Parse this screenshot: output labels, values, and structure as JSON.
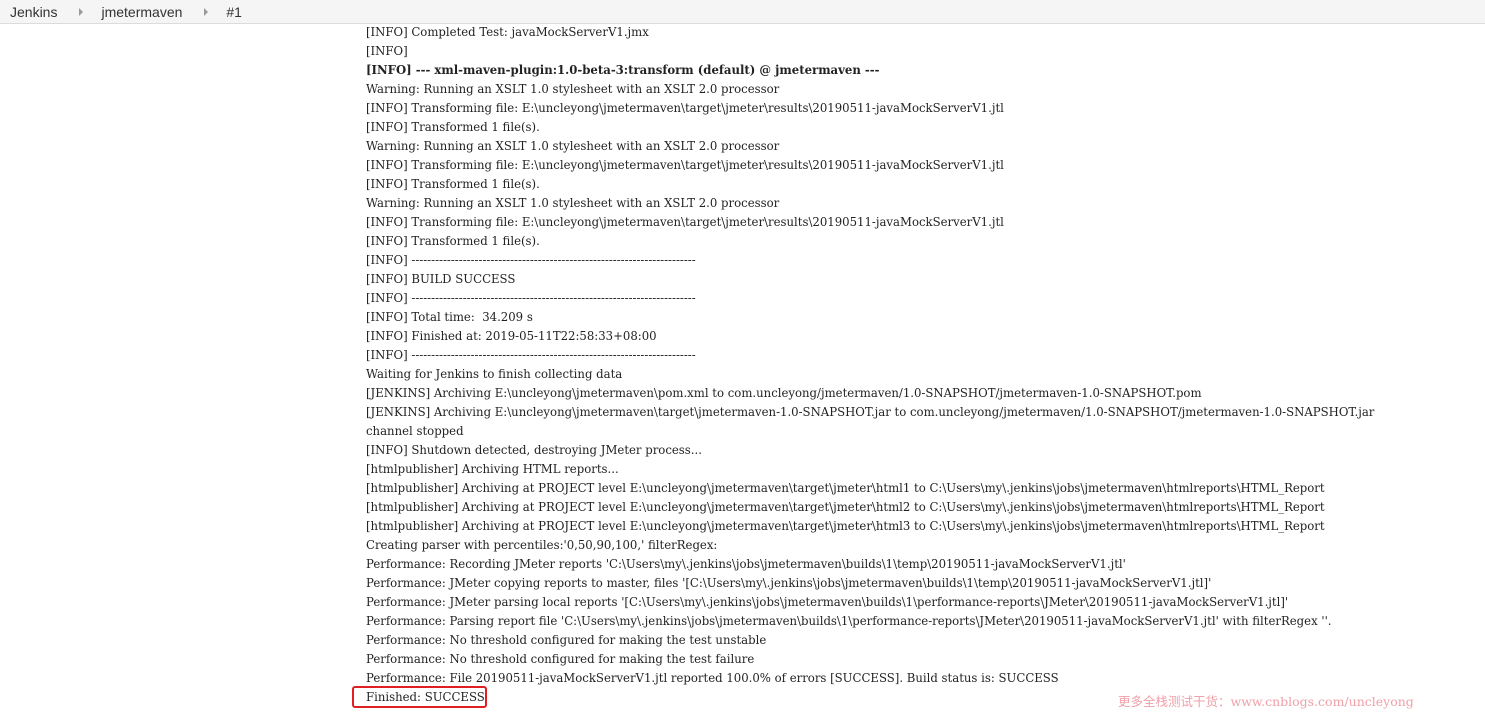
{
  "breadcrumb": {
    "items": [
      {
        "label": "Jenkins"
      },
      {
        "label": "jmetermaven"
      },
      {
        "label": "#1"
      }
    ]
  },
  "console": {
    "lines": [
      {
        "text": "[INFO] Completed Test: javaMockServerV1.jmx",
        "bold": false
      },
      {
        "text": "[INFO]",
        "bold": false
      },
      {
        "text": "[INFO] --- xml-maven-plugin:1.0-beta-3:transform (default) @ jmetermaven ---",
        "bold": true
      },
      {
        "text": "Warning: Running an XSLT 1.0 stylesheet with an XSLT 2.0 processor",
        "bold": false
      },
      {
        "text": "[INFO] Transforming file: E:\\uncleyong\\jmetermaven\\target\\jmeter\\results\\20190511-javaMockServerV1.jtl",
        "bold": false
      },
      {
        "text": "[INFO] Transformed 1 file(s).",
        "bold": false
      },
      {
        "text": "Warning: Running an XSLT 1.0 stylesheet with an XSLT 2.0 processor",
        "bold": false
      },
      {
        "text": "[INFO] Transforming file: E:\\uncleyong\\jmetermaven\\target\\jmeter\\results\\20190511-javaMockServerV1.jtl",
        "bold": false
      },
      {
        "text": "[INFO] Transformed 1 file(s).",
        "bold": false
      },
      {
        "text": "Warning: Running an XSLT 1.0 stylesheet with an XSLT 2.0 processor",
        "bold": false
      },
      {
        "text": "[INFO] Transforming file: E:\\uncleyong\\jmetermaven\\target\\jmeter\\results\\20190511-javaMockServerV1.jtl",
        "bold": false
      },
      {
        "text": "[INFO] Transformed 1 file(s).",
        "bold": false
      },
      {
        "text": "[INFO] ------------------------------------------------------------------------",
        "bold": false
      },
      {
        "text": "[INFO] BUILD SUCCESS",
        "bold": false
      },
      {
        "text": "[INFO] ------------------------------------------------------------------------",
        "bold": false
      },
      {
        "text": "[INFO] Total time:  34.209 s",
        "bold": false
      },
      {
        "text": "[INFO] Finished at: 2019-05-11T22:58:33+08:00",
        "bold": false
      },
      {
        "text": "[INFO] ------------------------------------------------------------------------",
        "bold": false
      },
      {
        "text": "Waiting for Jenkins to finish collecting data",
        "bold": false
      },
      {
        "text": "[JENKINS] Archiving E:\\uncleyong\\jmetermaven\\pom.xml to com.uncleyong/jmetermaven/1.0-SNAPSHOT/jmetermaven-1.0-SNAPSHOT.pom",
        "bold": false
      },
      {
        "text": "[JENKINS] Archiving E:\\uncleyong\\jmetermaven\\target\\jmetermaven-1.0-SNAPSHOT.jar to com.uncleyong/jmetermaven/1.0-SNAPSHOT/jmetermaven-1.0-SNAPSHOT.jar",
        "bold": false
      },
      {
        "text": "channel stopped",
        "bold": false
      },
      {
        "text": "[INFO] Shutdown detected, destroying JMeter process...",
        "bold": false
      },
      {
        "text": "[htmlpublisher] Archiving HTML reports...",
        "bold": false
      },
      {
        "text": "[htmlpublisher] Archiving at PROJECT level E:\\uncleyong\\jmetermaven\\target\\jmeter\\html1 to C:\\Users\\my\\.jenkins\\jobs\\jmetermaven\\htmlreports\\HTML_Report",
        "bold": false
      },
      {
        "text": "[htmlpublisher] Archiving at PROJECT level E:\\uncleyong\\jmetermaven\\target\\jmeter\\html2 to C:\\Users\\my\\.jenkins\\jobs\\jmetermaven\\htmlreports\\HTML_Report",
        "bold": false
      },
      {
        "text": "[htmlpublisher] Archiving at PROJECT level E:\\uncleyong\\jmetermaven\\target\\jmeter\\html3 to C:\\Users\\my\\.jenkins\\jobs\\jmetermaven\\htmlreports\\HTML_Report",
        "bold": false
      },
      {
        "text": "Creating parser with percentiles:'0,50,90,100,' filterRegex:",
        "bold": false
      },
      {
        "text": "Performance: Recording JMeter reports 'C:\\Users\\my\\.jenkins\\jobs\\jmetermaven\\builds\\1\\temp\\20190511-javaMockServerV1.jtl'",
        "bold": false
      },
      {
        "text": "Performance: JMeter copying reports to master, files '[C:\\Users\\my\\.jenkins\\jobs\\jmetermaven\\builds\\1\\temp\\20190511-javaMockServerV1.jtl]'",
        "bold": false
      },
      {
        "text": "Performance: JMeter parsing local reports '[C:\\Users\\my\\.jenkins\\jobs\\jmetermaven\\builds\\1\\performance-reports\\JMeter\\20190511-javaMockServerV1.jtl]'",
        "bold": false
      },
      {
        "text": "Performance: Parsing report file 'C:\\Users\\my\\.jenkins\\jobs\\jmetermaven\\builds\\1\\performance-reports\\JMeter\\20190511-javaMockServerV1.jtl' with filterRegex ''.",
        "bold": false
      },
      {
        "text": "Performance: No threshold configured for making the test unstable",
        "bold": false
      },
      {
        "text": "Performance: No threshold configured for making the test failure",
        "bold": false
      },
      {
        "text": "Performance: File 20190511-javaMockServerV1.jtl reported 100.0% of errors [SUCCESS]. Build status is: SUCCESS",
        "bold": false
      },
      {
        "text": "Finished: SUCCESS",
        "bold": false
      }
    ]
  },
  "highlight": {
    "color": "#e02020"
  },
  "watermark": {
    "text": "更多全栈测试干货：www.cnblogs.com/uncleyong"
  }
}
